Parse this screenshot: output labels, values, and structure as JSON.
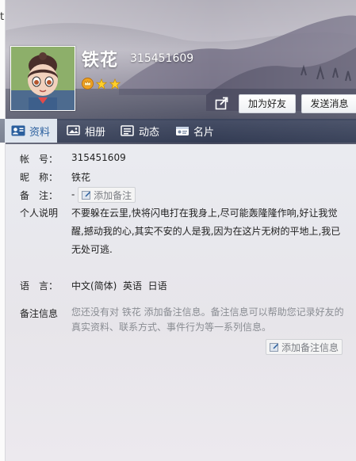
{
  "window": {
    "edge_char": "t"
  },
  "header": {
    "name": "铁花",
    "qq_number": "315451609",
    "buttons": {
      "add_friend": "加为好友",
      "send_message": "发送消息"
    }
  },
  "tabs": [
    {
      "label": "资料",
      "icon": "profile-card-icon",
      "active": true
    },
    {
      "label": "相册",
      "icon": "album-icon",
      "active": false
    },
    {
      "label": "动态",
      "icon": "feed-icon",
      "active": false
    },
    {
      "label": "名片",
      "icon": "name-card-icon",
      "active": false
    }
  ],
  "profile": {
    "account_label": "帐　号：",
    "account_value": "315451609",
    "nickname_label": "昵　称：",
    "nickname_value": "铁花",
    "remark_label": "备　注：",
    "remark_value": "-",
    "remark_button": "添加备注",
    "bio_label": "个人说明",
    "bio_value": "不要躲在云里,快将闪电打在我身上,尽可能轰隆隆作响,好让我觉醒,撼动我的心,其实不安的人是我,因为在这片无树的平地上,我已无处可逃.",
    "language_label": "语　言：",
    "language_value": "中文(简体)  英语  日语",
    "note_info_label": "备注信息",
    "note_info_text": "您还没有对 铁花 添加备注信息。备注信息可以帮助您记录好友的真实资料、联系方式、事件行为等一系列信息。",
    "note_info_button": "添加备注信息"
  },
  "colors": {
    "accent": "#2a5f9e",
    "muted": "#8a8d93"
  }
}
